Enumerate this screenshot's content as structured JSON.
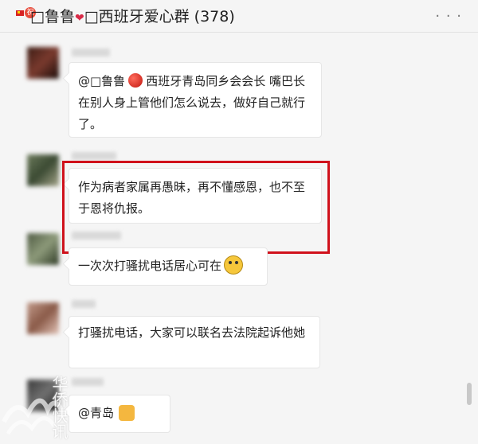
{
  "header": {
    "title": "□鲁鲁",
    "title_suffix": "□西班牙爱心群 (378)",
    "badge": "祝",
    "more_icon": "more-dots-icon"
  },
  "messages": [
    {
      "text_lead": "@□鲁鲁",
      "text_main": "西班牙青岛同乡会会长 嘴巴长在别人身上管他们怎么说去，做好自己就行了。",
      "name_visible": "宜■■■■"
    },
    {
      "text": "作为病者家属再愚昧，再不懂感恩，也不至于恩将仇报。",
      "name_visible": "Naiad■■"
    },
    {
      "text": "一次次打骚扰电话居心可在"
    },
    {
      "text": "打骚扰电话，大家可以联名去法院起诉他她"
    },
    {
      "text": "@青岛"
    }
  ],
  "watermark_text": "华侨快讯",
  "colors": {
    "highlight": "#d0111b",
    "bubble": "#ffffff",
    "background": "#f5f5f5"
  }
}
